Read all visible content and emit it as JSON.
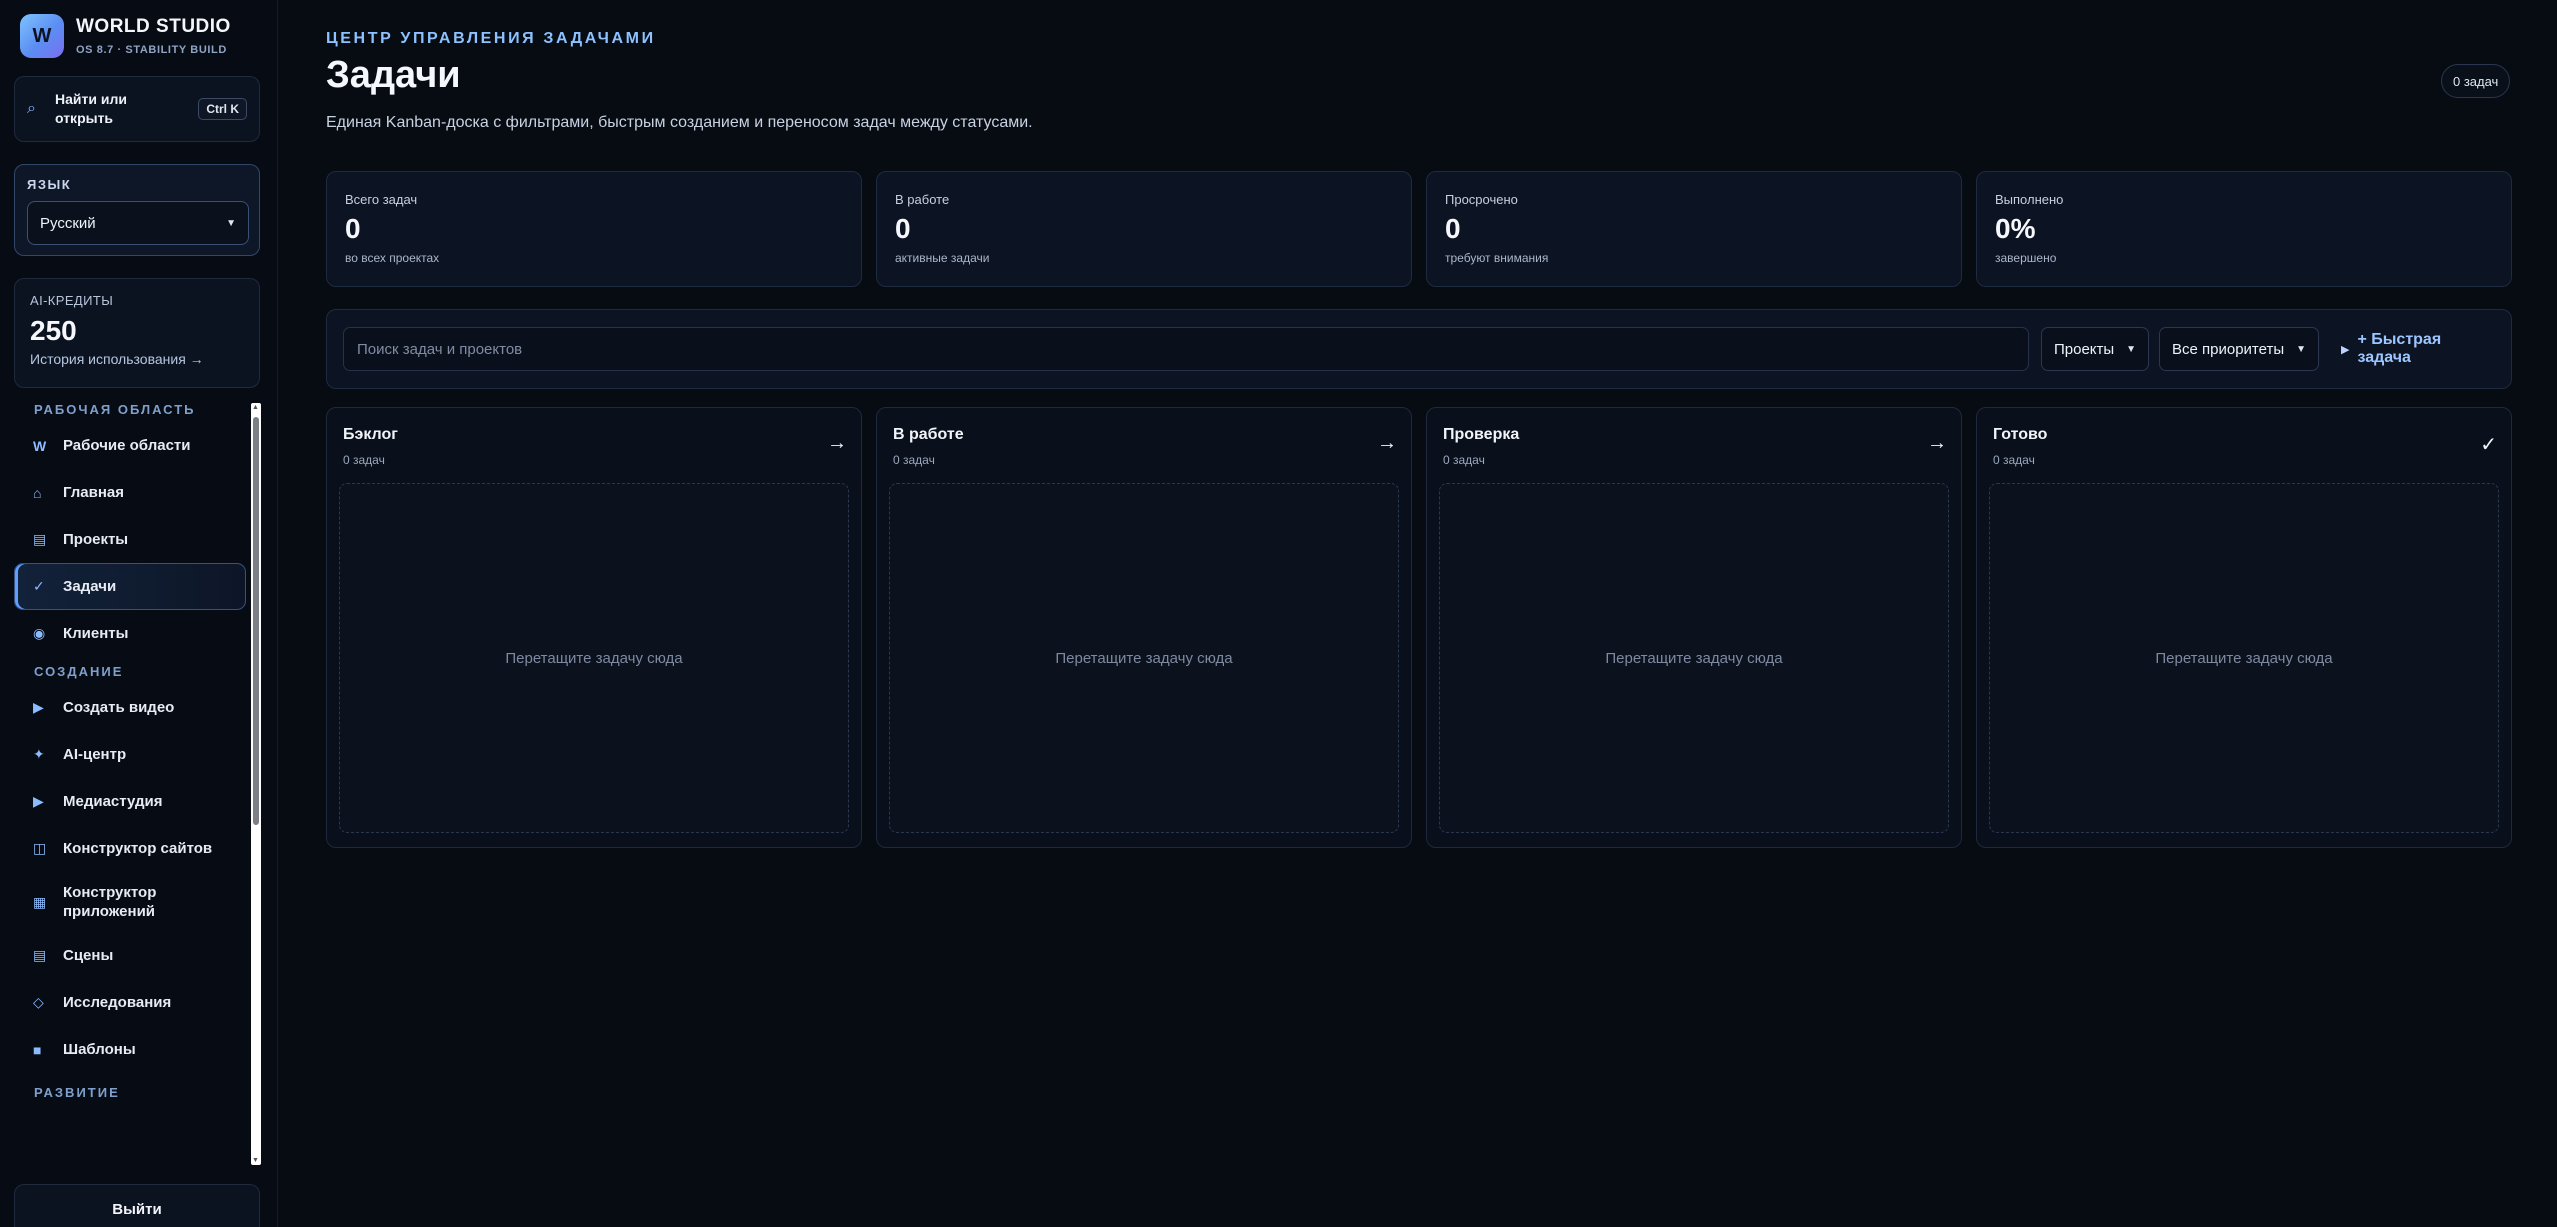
{
  "brand": {
    "logo": "W",
    "title": "WORLD STUDIO",
    "subtitle": "OS 8.7 · STABILITY BUILD"
  },
  "sidebar": {
    "search": {
      "icon": "search-icon",
      "label": "Найти или открыть",
      "shortcut": "Ctrl K"
    },
    "language": {
      "caption": "ЯЗЫК",
      "selected": "Русский"
    },
    "credits": {
      "caption": "AI-КРЕДИТЫ",
      "value": "250",
      "link": "История использования →"
    },
    "sections": {
      "workspace": "РАБОЧАЯ ОБЛАСТЬ",
      "creation": "СОЗДАНИЕ",
      "growth": "РАЗВИТИЕ"
    },
    "items": {
      "workspaces": {
        "glyph": "W",
        "label": "Рабочие области"
      },
      "home": {
        "glyph": "⌂",
        "label": "Главная"
      },
      "projects": {
        "glyph": "▤",
        "label": "Проекты"
      },
      "tasks": {
        "glyph": "✓",
        "label": "Задачи"
      },
      "clients": {
        "glyph": "◉",
        "label": "Клиенты"
      },
      "create_video": {
        "glyph": "▶",
        "label": "Создать видео"
      },
      "ai_center": {
        "glyph": "✦",
        "label": "AI-центр"
      },
      "media_studio": {
        "glyph": "▶",
        "label": "Медиастудия"
      },
      "site_builder": {
        "glyph": "◫",
        "label": "Конструктор сайтов"
      },
      "app_builder": {
        "glyph": "▦",
        "label": "Конструктор приложений"
      },
      "scenes": {
        "glyph": "▤",
        "label": "Сцены"
      },
      "research": {
        "glyph": "◇",
        "label": "Исследования"
      },
      "templates": {
        "glyph": "■",
        "label": "Шаблоны"
      }
    },
    "logout": "Выйти"
  },
  "header": {
    "eyebrow": "ЦЕНТР УПРАВЛЕНИЯ ЗАДАЧАМИ",
    "title": "Задачи",
    "description": "Единая Kanban-доска с фильтрами, быстрым созданием и переносом задач между статусами.",
    "count": "0 задач"
  },
  "stats": [
    {
      "label": "Всего задач",
      "value": "0",
      "hint": "во всех проектах"
    },
    {
      "label": "В работе",
      "value": "0",
      "hint": "активные задачи"
    },
    {
      "label": "Просрочено",
      "value": "0",
      "hint": "требуют внимания"
    },
    {
      "label": "Выполнено",
      "value": "0%",
      "hint": "завершено"
    }
  ],
  "toolbar": {
    "search_placeholder": "Поиск задач и проектов",
    "projects_filter": "Проекты",
    "priority_filter": "Все приоритеты",
    "quick_task": "+ Быстрая задача"
  },
  "columns": [
    {
      "title": "Бэклог",
      "count": "0 задач",
      "arrow": "→",
      "empty": "Перетащите задачу сюда"
    },
    {
      "title": "В работе",
      "count": "0 задач",
      "arrow": "→",
      "empty": "Перетащите задачу сюда"
    },
    {
      "title": "Проверка",
      "count": "0 задач",
      "arrow": "→",
      "empty": "Перетащите задачу сюда"
    },
    {
      "title": "Готово",
      "count": "0 задач",
      "arrow": "✓",
      "empty": "Перетащите задачу сюда"
    }
  ],
  "colors": {
    "accent": "#8cc2ff",
    "background": "#070b12",
    "panel": "#0c1322"
  }
}
